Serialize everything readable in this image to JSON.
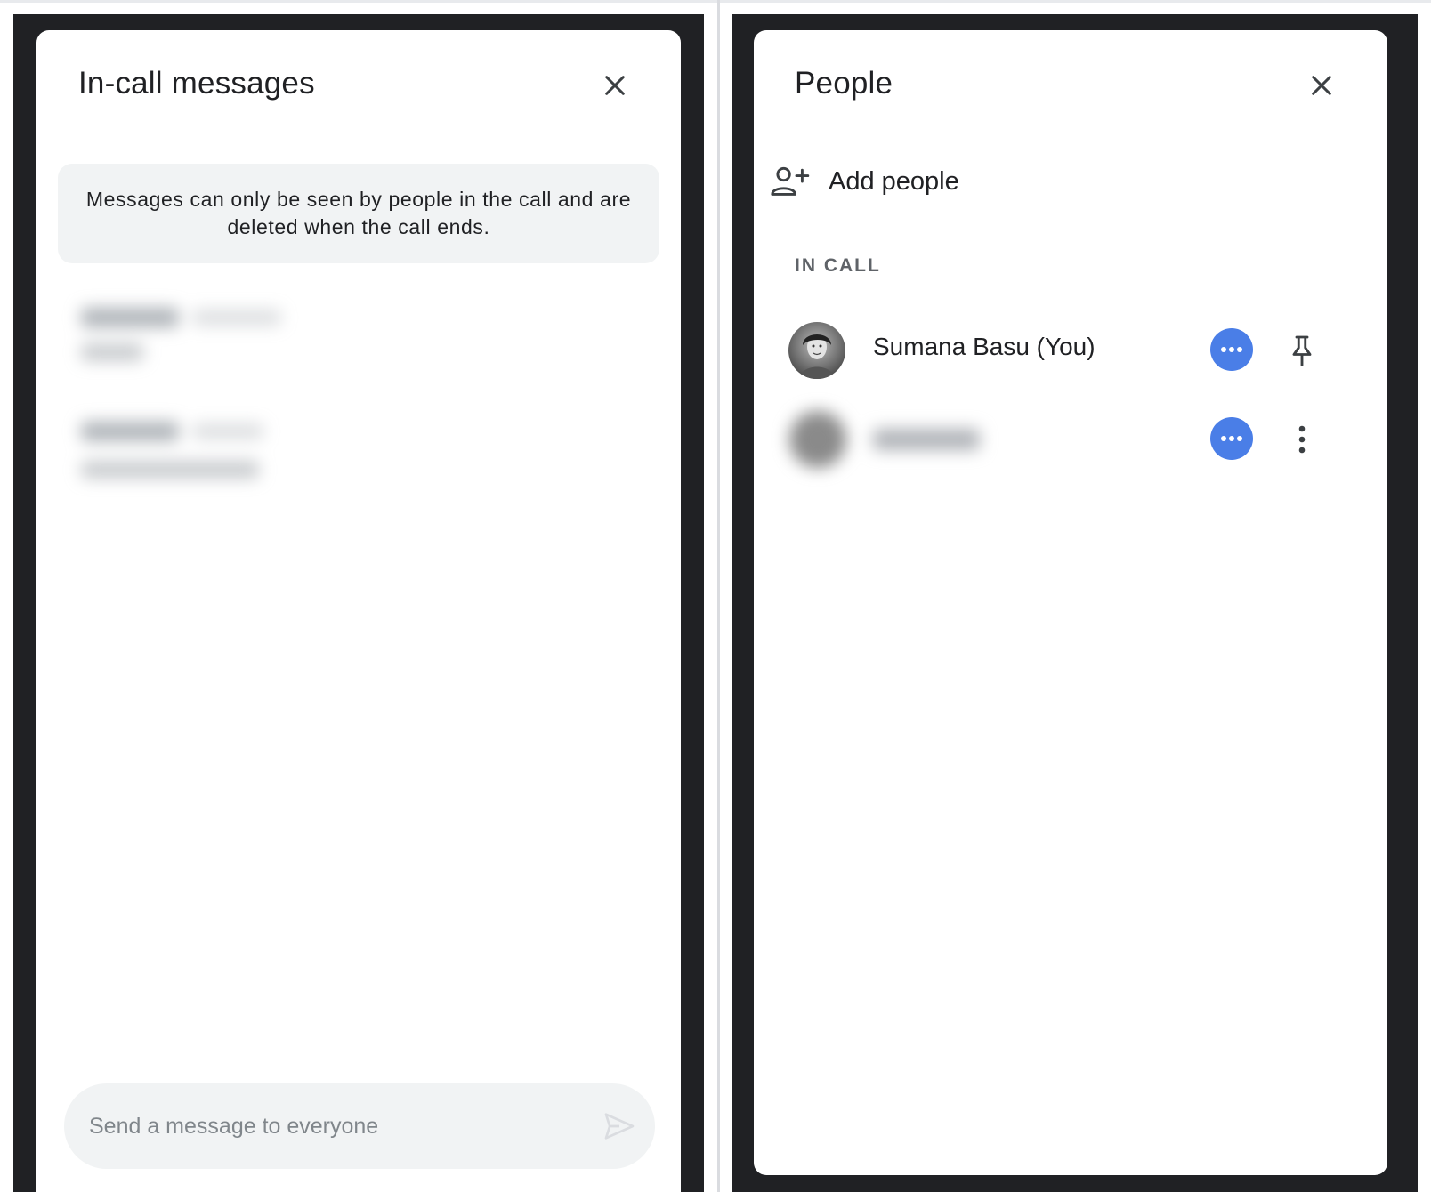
{
  "chat_panel": {
    "title": "In-call messages",
    "notice": "Messages can only be seen by people in the call and are deleted when the call ends.",
    "composer": {
      "placeholder": "Send a message to everyone",
      "value": ""
    },
    "icons": {
      "close": "close-icon",
      "send": "send-icon"
    }
  },
  "people_panel": {
    "title": "People",
    "add_people_label": "Add people",
    "section_label": "IN CALL",
    "participants": [
      {
        "name": "Sumana Basu (You)",
        "status_icon": "more-horizontal-icon",
        "action_icon": "pin-icon"
      },
      {
        "name": "",
        "status_icon": "more-horizontal-icon",
        "action_icon": "more-vert-icon"
      }
    ],
    "icons": {
      "close": "close-icon",
      "add_person": "person-add-icon"
    }
  },
  "colors": {
    "frame": "#202124",
    "notice_bg": "#f1f3f4",
    "accent": "#4a7ee7"
  }
}
